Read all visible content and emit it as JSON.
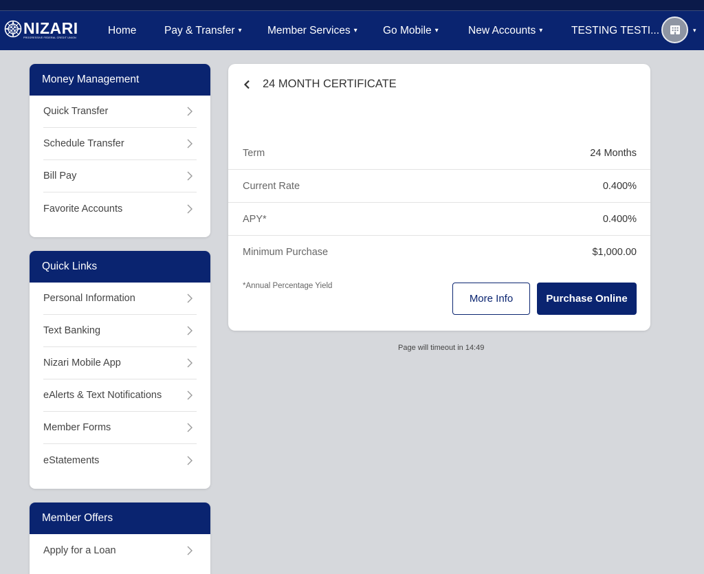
{
  "brand": {
    "name": "NIZARI",
    "tagline": "PROGRESSIVE FEDERAL CREDIT UNION",
    "navy": "#0a2470",
    "background": "#d6d8dc"
  },
  "nav": {
    "items": [
      {
        "label": "Home",
        "dropdown": false
      },
      {
        "label": "Pay & Transfer",
        "dropdown": true
      },
      {
        "label": "Member Services",
        "dropdown": true
      },
      {
        "label": "Go Mobile",
        "dropdown": true
      },
      {
        "label": "New Accounts",
        "dropdown": true
      },
      {
        "label": "TESTING TESTI...",
        "dropdown": false
      }
    ],
    "caret": "▾",
    "avatar_icon": "building-icon"
  },
  "sidebar": {
    "money_management": {
      "title": "Money Management",
      "items": [
        "Quick Transfer",
        "Schedule Transfer",
        "Bill Pay",
        "Favorite Accounts"
      ]
    },
    "quick_links": {
      "title": "Quick Links",
      "items": [
        "Personal Information",
        "Text Banking",
        "Nizari Mobile App",
        "eAlerts & Text Notifications",
        "Member Forms",
        "eStatements"
      ]
    },
    "member_offers": {
      "title": "Member Offers",
      "items": [
        "Apply for a Loan"
      ]
    }
  },
  "certificate": {
    "title": "24 MONTH CERTIFICATE",
    "rows": [
      {
        "label": "Term",
        "value": "24 Months"
      },
      {
        "label": "Current Rate",
        "value": "0.400%"
      },
      {
        "label": "APY*",
        "value": "0.400%"
      },
      {
        "label": "Minimum Purchase",
        "value": "$1,000.00"
      }
    ],
    "footnote": "*Annual Percentage Yield",
    "more_info_label": "More Info",
    "purchase_label": "Purchase Online"
  },
  "timeout_text": "Page will timeout in 14:49"
}
